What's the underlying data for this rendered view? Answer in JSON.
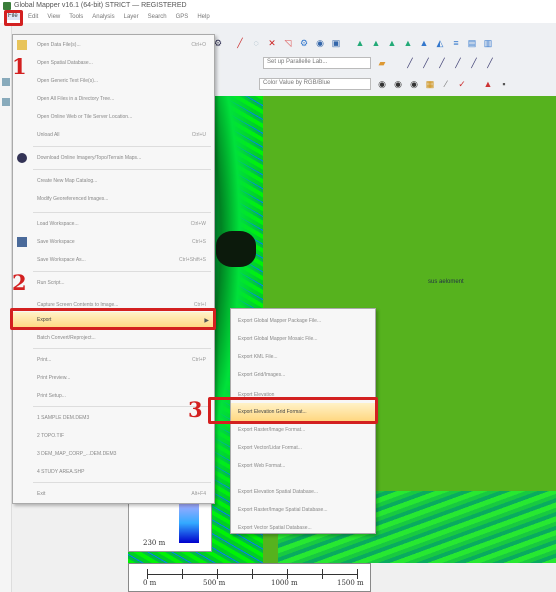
{
  "window": {
    "title": "Global Mapper v16.1 (64-bit) STRICT — REGISTERED"
  },
  "menubar": {
    "items": [
      "File",
      "Edit",
      "View",
      "Tools",
      "Analysis",
      "Layer",
      "Search",
      "GPS",
      "Help"
    ]
  },
  "toolbar": {
    "dropdown_1": "Set up Parallelle Lab...",
    "dropdown_2": "Color Value by RGB/Blue"
  },
  "file_menu": {
    "items": [
      {
        "label": "Open Data File(s)...",
        "shortcut": "Ctrl+O"
      },
      {
        "label": "Open Spatial Database...",
        "shortcut": ""
      },
      {
        "label": "Open Generic Text File(s)...",
        "shortcut": ""
      },
      {
        "label": "Open All Files in a Directory Tree...",
        "shortcut": ""
      },
      {
        "label": "Open Online Web or Tile Server Location...",
        "shortcut": ""
      },
      {
        "label": "Unload All",
        "shortcut": "Ctrl+U"
      },
      {
        "label": "Download Online Imagery/Topo/Terrain Maps...",
        "shortcut": ""
      },
      {
        "label": "Create New Map Catalog...",
        "shortcut": ""
      },
      {
        "label": "Modify Georeferenced Images...",
        "shortcut": ""
      },
      {
        "label": "Load Workspace...",
        "shortcut": "Ctrl+W"
      },
      {
        "label": "Save Workspace",
        "shortcut": "Ctrl+S"
      },
      {
        "label": "Save Workspace As...",
        "shortcut": "Ctrl+Shift+S"
      },
      {
        "label": "Run Script...",
        "shortcut": ""
      },
      {
        "label": "Capture Screen Contents to Image...",
        "shortcut": "Ctrl+I"
      },
      {
        "label": "Export",
        "shortcut": ""
      },
      {
        "label": "Batch Convert/Reproject...",
        "shortcut": ""
      },
      {
        "label": "Print...",
        "shortcut": "Ctrl+P"
      },
      {
        "label": "Print Preview...",
        "shortcut": ""
      },
      {
        "label": "Print Setup...",
        "shortcut": ""
      },
      {
        "label": "1 SAMPLE DEM.DEM3",
        "shortcut": ""
      },
      {
        "label": "2 TOPO.TIF",
        "shortcut": ""
      },
      {
        "label": "3 DEM_MAP_CORP_...DEM.DEM3",
        "shortcut": ""
      },
      {
        "label": "4 STUDY AREA.SHP",
        "shortcut": ""
      },
      {
        "label": "Exit",
        "shortcut": "Alt+F4"
      }
    ]
  },
  "export_submenu": {
    "items": [
      "Export Global Mapper Package File...",
      "Export Global Mapper Mosaic File...",
      "Export KML File...",
      "Export Grid/Images...",
      "Export Elevation",
      "Export Elevation Grid Format...",
      "Export Raster/Image Format...",
      "Export Vector/Lidar Format...",
      "Export Web Format...",
      "Export Elevation Spatial Database...",
      "Export Raster/Image Spatial Database...",
      "Export Vector Spatial Database..."
    ]
  },
  "annotations": {
    "step1": "1",
    "step2": "2",
    "step3": "3"
  },
  "map": {
    "label": "sus aeloment",
    "legend_value": "230 m",
    "scale_labels": [
      "0 m",
      "500 m",
      "1000 m",
      "1500 m"
    ]
  },
  "colors": {
    "highlight_red": "#d32020",
    "terrain_green": "#56b21e",
    "menu_highlight": "#ffd780"
  }
}
